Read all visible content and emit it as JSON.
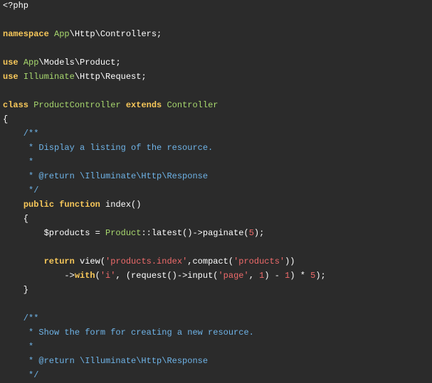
{
  "editor": {
    "background": "#2b2b2b",
    "colors": {
      "keyword": "#f8c85a",
      "class_name": "#a8d86e",
      "comment": "#6fb4e8",
      "string": "#f06b6b",
      "plain": "#ffffff"
    },
    "lines": [
      [
        [
          "plain",
          "<?php"
        ]
      ],
      [],
      [
        [
          "kw",
          "namespace"
        ],
        [
          "plain",
          " "
        ],
        [
          "ns",
          "App"
        ],
        [
          "plain",
          "\\Http\\Controllers;"
        ]
      ],
      [],
      [
        [
          "kw",
          "use"
        ],
        [
          "plain",
          " "
        ],
        [
          "ns",
          "App"
        ],
        [
          "plain",
          "\\Models\\Product;"
        ]
      ],
      [
        [
          "kw",
          "use"
        ],
        [
          "plain",
          " "
        ],
        [
          "ns",
          "Illuminate"
        ],
        [
          "plain",
          "\\Http\\Request;"
        ]
      ],
      [],
      [
        [
          "kw",
          "class"
        ],
        [
          "plain",
          " "
        ],
        [
          "cls",
          "ProductController"
        ],
        [
          "plain",
          " "
        ],
        [
          "kw",
          "extends"
        ],
        [
          "plain",
          " "
        ],
        [
          "cls",
          "Controller"
        ]
      ],
      [
        [
          "plain",
          "{"
        ]
      ],
      [
        [
          "cmt",
          "    /**"
        ]
      ],
      [
        [
          "cmt",
          "     * Display a listing of the resource."
        ]
      ],
      [
        [
          "cmt",
          "     *"
        ]
      ],
      [
        [
          "cmt",
          "     * @return \\Illuminate\\Http\\Response"
        ]
      ],
      [
        [
          "cmt",
          "     */"
        ]
      ],
      [
        [
          "plain",
          "    "
        ],
        [
          "kw",
          "public"
        ],
        [
          "plain",
          " "
        ],
        [
          "kw",
          "function"
        ],
        [
          "plain",
          " index()"
        ]
      ],
      [
        [
          "plain",
          "    {"
        ]
      ],
      [
        [
          "plain",
          "        $products = "
        ],
        [
          "cls",
          "Product"
        ],
        [
          "plain",
          "::latest()->paginate("
        ],
        [
          "num",
          "5"
        ],
        [
          "plain",
          ");"
        ]
      ],
      [],
      [
        [
          "plain",
          "        "
        ],
        [
          "kw",
          "return"
        ],
        [
          "plain",
          " view("
        ],
        [
          "str",
          "'products.index'"
        ],
        [
          "plain",
          ",compact("
        ],
        [
          "str",
          "'products'"
        ],
        [
          "plain",
          "))"
        ]
      ],
      [
        [
          "plain",
          "            ->"
        ],
        [
          "kw",
          "with"
        ],
        [
          "plain",
          "("
        ],
        [
          "str",
          "'i'"
        ],
        [
          "plain",
          ", (request()->input("
        ],
        [
          "str",
          "'page'"
        ],
        [
          "plain",
          ", "
        ],
        [
          "num",
          "1"
        ],
        [
          "plain",
          ") - "
        ],
        [
          "num",
          "1"
        ],
        [
          "plain",
          ") * "
        ],
        [
          "num",
          "5"
        ],
        [
          "plain",
          ");"
        ]
      ],
      [
        [
          "plain",
          "    }"
        ]
      ],
      [],
      [
        [
          "cmt",
          "    /**"
        ]
      ],
      [
        [
          "cmt",
          "     * Show the form for creating a new resource."
        ]
      ],
      [
        [
          "cmt",
          "     *"
        ]
      ],
      [
        [
          "cmt",
          "     * @return \\Illuminate\\Http\\Response"
        ]
      ],
      [
        [
          "cmt",
          "     */"
        ]
      ]
    ]
  }
}
